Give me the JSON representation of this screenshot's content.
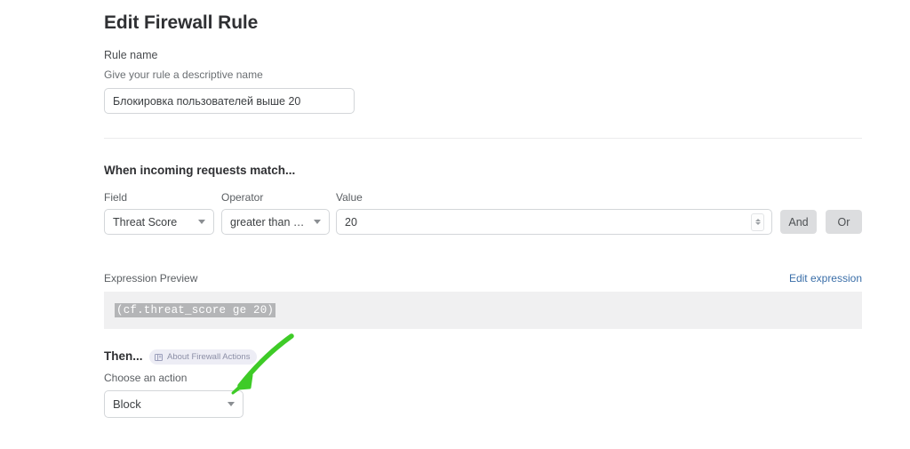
{
  "page": {
    "title": "Edit Firewall Rule"
  },
  "rule_name": {
    "label": "Rule name",
    "help_text": "Give your rule a descriptive name",
    "value": "Блокировка пользователей выше 20",
    "placeholder": "Rule name"
  },
  "match_section": {
    "heading": "When incoming requests match...",
    "field": {
      "label": "Field",
      "selected": "Threat Score"
    },
    "operator": {
      "label": "Operator",
      "selected": "greater than o..."
    },
    "value": {
      "label": "Value",
      "value": "20",
      "placeholder": "Enter value"
    },
    "and_button": "And",
    "or_button": "Or"
  },
  "expression": {
    "label": "Expression Preview",
    "edit_link": "Edit expression",
    "code": "(cf.threat_score ge 20)"
  },
  "then_section": {
    "heading": "Then...",
    "badge_label": "About Firewall Actions",
    "action_label": "Choose an action",
    "action_selected": "Block"
  },
  "annotation": {
    "arrow_color": "#3ecb27"
  }
}
